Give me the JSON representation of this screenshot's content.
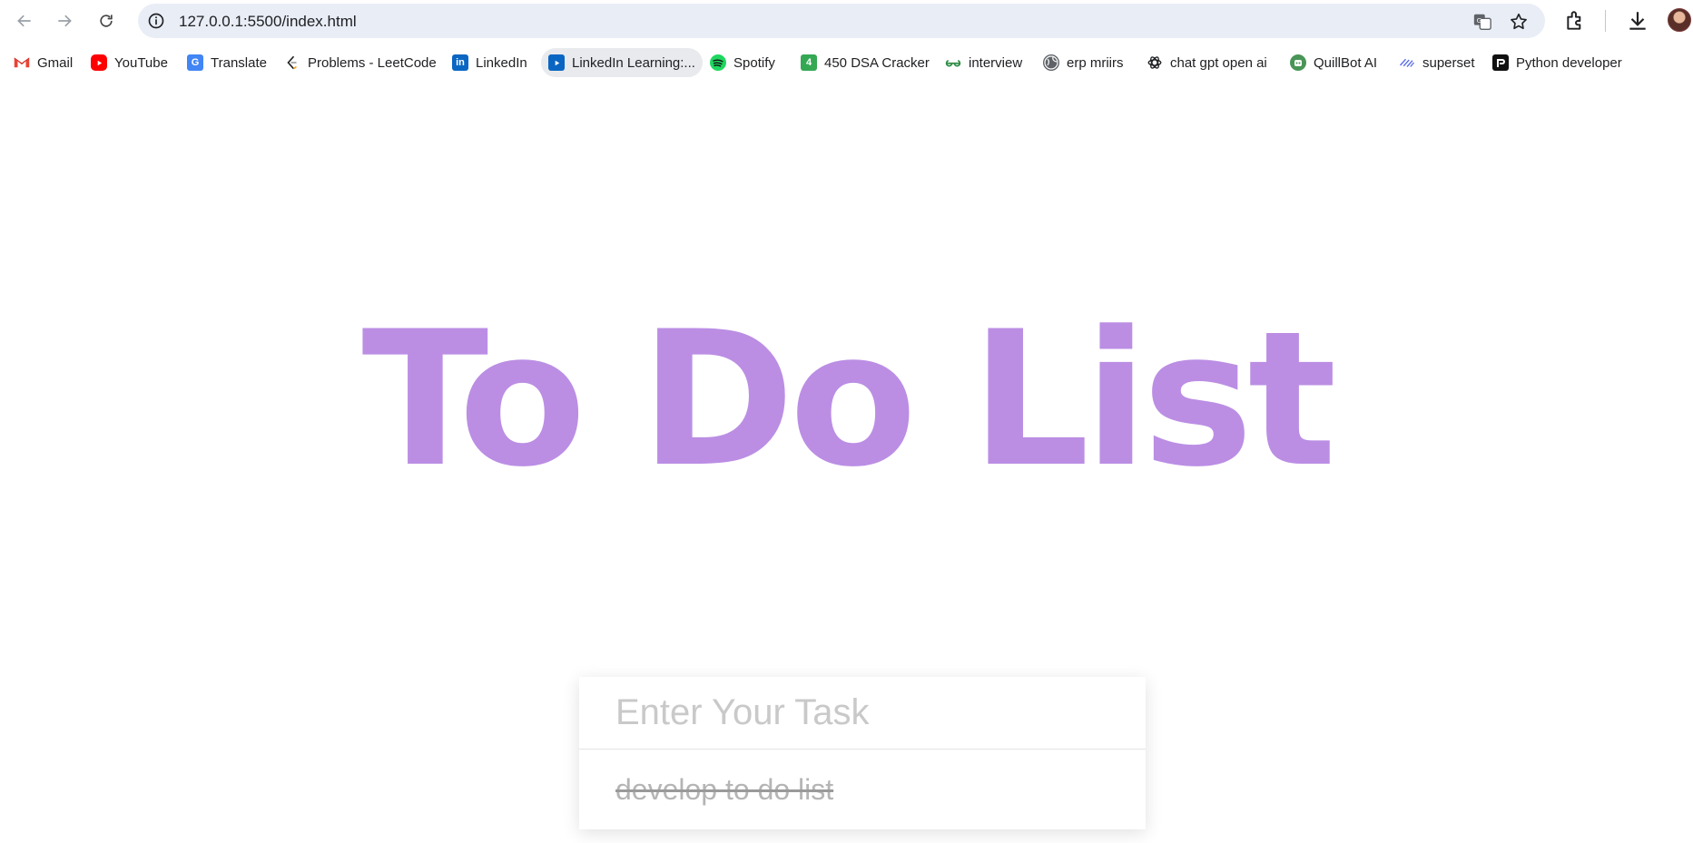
{
  "browser": {
    "url": "127.0.0.1:5500/index.html"
  },
  "bookmarks": [
    {
      "label": "Gmail",
      "icon": "gmail-icon"
    },
    {
      "label": "YouTube",
      "icon": "youtube-icon"
    },
    {
      "label": "Translate",
      "icon": "translate-icon"
    },
    {
      "label": "Problems - LeetCode",
      "icon": "leetcode-icon"
    },
    {
      "label": "LinkedIn",
      "icon": "linkedin-icon"
    },
    {
      "label": "LinkedIn Learning:...",
      "icon": "linkedin-learning-icon"
    },
    {
      "label": "Spotify",
      "icon": "spotify-icon"
    },
    {
      "label": "450 DSA Cracker",
      "icon": "dsa-cracker-icon",
      "badge": "4"
    },
    {
      "label": "interview",
      "icon": "geeksforgeeks-icon"
    },
    {
      "label": "erp mriirs",
      "icon": "globe-icon"
    },
    {
      "label": "chat gpt open ai",
      "icon": "openai-icon"
    },
    {
      "label": "QuillBot AI",
      "icon": "quillbot-icon"
    },
    {
      "label": "superset",
      "icon": "superset-icon"
    },
    {
      "label": "Python developer",
      "icon": "python-developer-icon"
    }
  ],
  "app": {
    "title": "To Do List",
    "input_placeholder": "Enter Your Task",
    "tasks": [
      {
        "text": "develop to  do list",
        "done": true
      }
    ]
  },
  "colors": {
    "title": "#bb8ee4",
    "omnibox_bg": "#e9edf6"
  }
}
